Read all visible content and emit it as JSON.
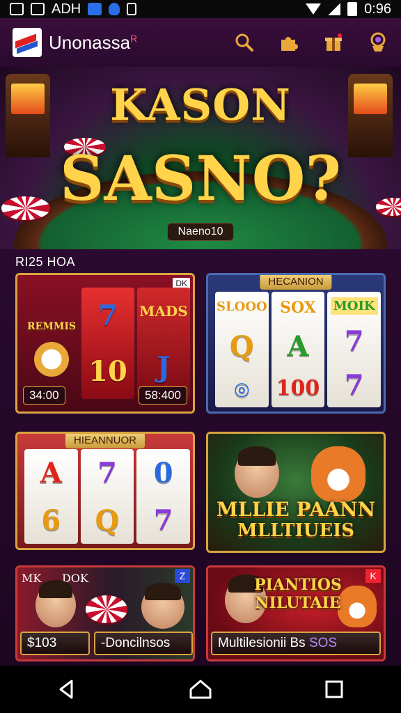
{
  "status_bar": {
    "carrier": "ADH",
    "time": "0:96"
  },
  "app_bar": {
    "title": "Unonassa",
    "title_mark": "R"
  },
  "hero": {
    "title_line1": "KASON",
    "title_line2": "SASNO?",
    "pill_label": "Naeno10"
  },
  "section": {
    "label": "RI25 HOA"
  },
  "cards": [
    {
      "kind": "slot",
      "corner": "DK",
      "left_label": "REMMIS",
      "top_right_label": "MADS",
      "reel_symbols": [
        "7",
        "10",
        "J"
      ],
      "amount_left": "34:00",
      "amount_right": "58:400"
    },
    {
      "kind": "slot",
      "badge": "HECANION",
      "top_labels": [
        "SLOOO",
        "SOX",
        "MOIK"
      ],
      "reel_symbols": [
        "Q",
        "A",
        "7"
      ],
      "bottom_symbols": [
        "",
        "100",
        "7"
      ]
    },
    {
      "kind": "slot",
      "badge": "HIEANNUOR",
      "reel_symbols": [
        "A",
        "7",
        "0",
        "6",
        "Q",
        "7"
      ]
    },
    {
      "kind": "promo",
      "title_line1": "MLLIE PAANN",
      "title_line2": "MLLTIUEIS"
    },
    {
      "kind": "promo",
      "top_label_1": "MK",
      "top_label_2": "DOK",
      "corner": "Z",
      "amount_left": "$103",
      "amount_right": "-Doncilnsos"
    },
    {
      "kind": "promo",
      "corner": "K",
      "title_line1": "PIANTIOS",
      "title_line2": "NILUTAIE",
      "bar_text": "Multilesionii Bs ",
      "bar_accent": "SOS"
    }
  ],
  "colors": {
    "accent_gold": "#d9a441",
    "app_bar": "#3a0e3c",
    "background": "#1e0622"
  },
  "icons": [
    "search-icon",
    "puzzle-icon",
    "gift-icon",
    "medal-icon",
    "back-icon",
    "home-icon",
    "recents-icon"
  ]
}
